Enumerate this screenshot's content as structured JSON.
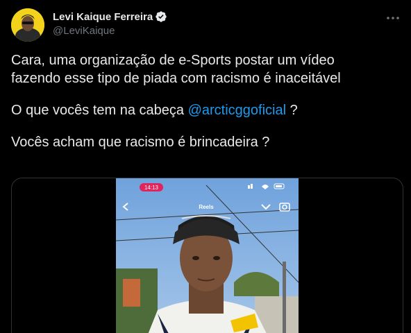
{
  "author": {
    "display_name": "Levi Kaique Ferreira",
    "handle": "@LeviKaique",
    "verified_icon": "verified-badge-icon",
    "avatar_color": "#f2d21b"
  },
  "tweet": {
    "line1": "Cara, uma organização de e-Sports postar um vídeo",
    "line2": "fazendo esse tipo de piada com racismo é inaceitável",
    "line3_prefix": "O que vocês tem na cabeça ",
    "mention": "@arcticggoficial",
    "line3_suffix": " ?",
    "line4": "Vocês acham que racismo é brincadeira ?"
  },
  "video": {
    "status_time": "14:13",
    "reels_label": "Reels"
  },
  "colors": {
    "background": "#000000",
    "text": "#e7e9ea",
    "secondary": "#71767b",
    "accent": "#1d9bf0",
    "border": "#2f3336",
    "time_pill": "#e0245e"
  }
}
